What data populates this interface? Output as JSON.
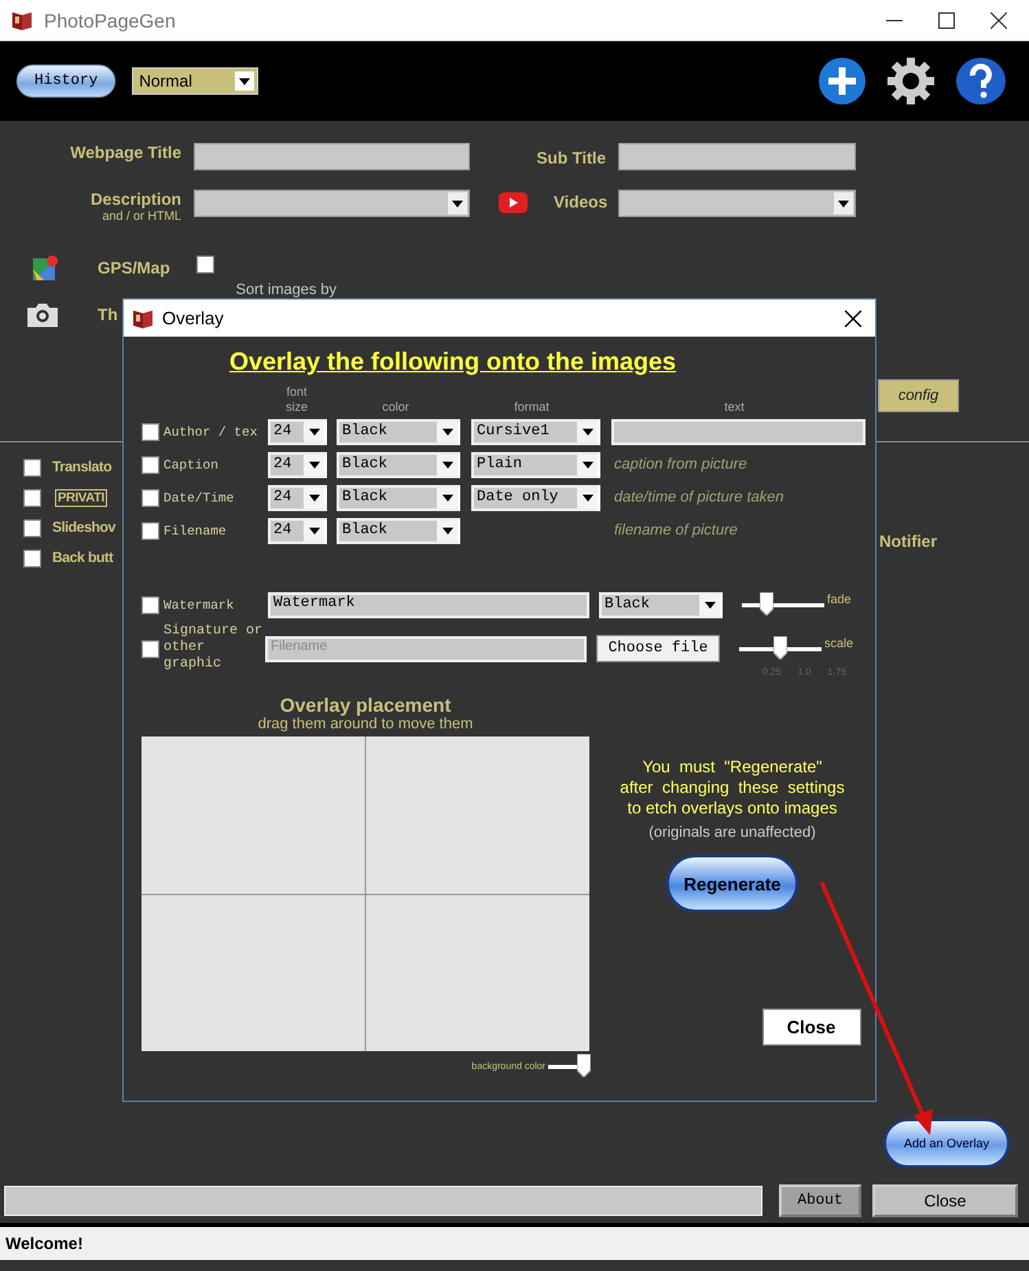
{
  "window": {
    "title": "PhotoPageGen"
  },
  "toolbar": {
    "history_button": "History",
    "mode": "Normal"
  },
  "form": {
    "webpage_title": "Webpage Title",
    "sub_title": "Sub Title",
    "description": "Description",
    "description_hint": "and / or HTML",
    "videos": "Videos",
    "gps_map": {
      "label": "GPS/Map",
      "checked": false
    },
    "thumbnails": {
      "label": "Th",
      "sort_label": "Sort images by"
    }
  },
  "config_button": "config",
  "options": [
    {
      "kind": "text",
      "label": "Translato",
      "checked": false
    },
    {
      "kind": "badge",
      "label": "PRIVATI",
      "checked": false
    },
    {
      "kind": "text",
      "label": "Slideshov",
      "checked": false
    },
    {
      "kind": "text",
      "label": "Back butt",
      "checked": false
    }
  ],
  "notifier": "Notifier",
  "add_overlay_button": "Add an Overlay",
  "footer": {
    "about_button": "About",
    "close_button": "Close"
  },
  "status_bar": "Welcome!",
  "overlay": {
    "title": "Overlay",
    "heading": "Overlay the following onto the images",
    "columns": {
      "font_size": "font size",
      "color_name": "color",
      "format": "format",
      "text": "text"
    },
    "rows": [
      {
        "label": "Author / tex",
        "checked": false,
        "font_size": "24",
        "color_name": "Black",
        "format": "Cursive1",
        "kind": "input"
      },
      {
        "label": "Caption",
        "checked": false,
        "font_size": "24",
        "color_name": "Black",
        "format": "Plain",
        "kind": "note",
        "note": "caption from picture"
      },
      {
        "label": "Date/Time",
        "checked": false,
        "font_size": "24",
        "color_name": "Black",
        "format": "Date only",
        "kind": "note",
        "note": "date/time of picture taken"
      },
      {
        "label": "Filename",
        "checked": false,
        "font_size": "24",
        "color_name": "Black",
        "kind": "note",
        "note": "filename of picture"
      }
    ],
    "watermark": {
      "label": "Watermark",
      "checked": false,
      "value": "Watermark",
      "color_name": "Black"
    },
    "signature": {
      "label": "Signature or other graphic",
      "checked": false,
      "placeholder": "Filename",
      "button": "Choose file"
    },
    "fade": {
      "label": "fade",
      "level": 0.3
    },
    "scale": {
      "label": "scale",
      "level": 0.5,
      "ticks": [
        "0.25",
        "1.0",
        "1.75"
      ]
    },
    "placement": {
      "title": "Overlay placement",
      "subtitle": "drag them around to move them"
    },
    "background_slider": {
      "label": "background color",
      "level": 0.85
    },
    "notice": [
      "You  must  \"Regenerate\"",
      "after  changing  these  settings",
      "to etch overlays onto images"
    ],
    "notice_note": "(originals are unaffected)",
    "regenerate_button": "Regenerate",
    "close_button": "Close"
  },
  "annotation": {
    "kind": "arrow"
  }
}
